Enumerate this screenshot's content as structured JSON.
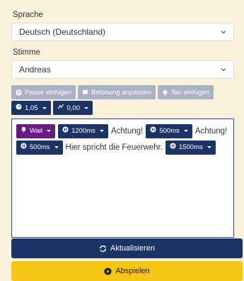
{
  "language": {
    "label": "Sprache",
    "value": "Deutsch (Deutschland)"
  },
  "voice": {
    "label": "Stimme",
    "value": "Andreas"
  },
  "toolbar": {
    "pause_label": "Pause einfügen",
    "emphasis_label": "Betonung anpassen",
    "tone_label": "Ton einfügen",
    "speed_value": "1,05",
    "pitch_value": "0,00"
  },
  "editor": {
    "line1": {
      "sound_chip": "Wail",
      "pause1": "1200ms",
      "text1": "Achtung!",
      "pause2": "500ms",
      "text2": "Achtung!"
    },
    "line2": {
      "pause3": "500ms",
      "text3": "Hier spricht die Feuerwehr.",
      "pause4": "1500ms"
    }
  },
  "actions": {
    "update_label": "Aktualisieren",
    "play_label": "Abspielen"
  },
  "colors": {
    "background": "#fbf0dc",
    "navy": "#1c3366",
    "purple": "#6a1a86",
    "yellow": "#f5c518",
    "disabled": "#a9b1c7"
  }
}
